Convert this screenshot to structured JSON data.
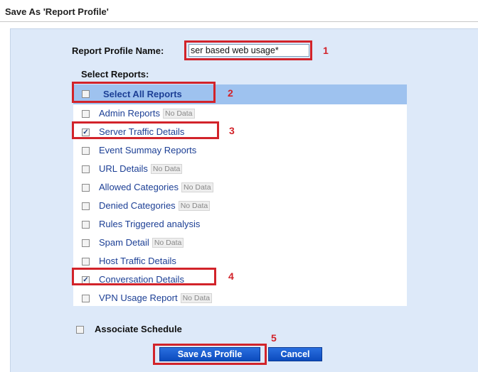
{
  "page": {
    "title": "Save As 'Report Profile'"
  },
  "form": {
    "profile_name_label": "Report Profile Name:",
    "profile_name_value": "ser based web usage*",
    "select_reports_label": "Select Reports:",
    "select_all_label": "Select All Reports",
    "reports": [
      {
        "label": "Admin Reports",
        "no_data": "No Data",
        "checked": false
      },
      {
        "label": "Server Traffic Details",
        "no_data": "",
        "checked": true
      },
      {
        "label": "Event Summay Reports",
        "no_data": "",
        "checked": false
      },
      {
        "label": "URL Details",
        "no_data": "No Data",
        "checked": false
      },
      {
        "label": "Allowed Categories",
        "no_data": "No Data",
        "checked": false
      },
      {
        "label": "Denied Categories",
        "no_data": "No Data",
        "checked": false
      },
      {
        "label": "Rules Triggered analysis",
        "no_data": "",
        "checked": false
      },
      {
        "label": "Spam Detail",
        "no_data": "No Data",
        "checked": false
      },
      {
        "label": "Host Traffic Details",
        "no_data": "",
        "checked": false
      },
      {
        "label": "Conversation Details",
        "no_data": "",
        "checked": true
      },
      {
        "label": "VPN Usage Report",
        "no_data": "No Data",
        "checked": false
      }
    ],
    "associate_schedule_label": "Associate Schedule",
    "save_button": "Save As Profile",
    "cancel_button": "Cancel"
  },
  "annotations": [
    "1",
    "2",
    "3",
    "4",
    "5"
  ],
  "colors": {
    "panel_bg": "#dde9f9",
    "header_row_bg": "#9ec2ef",
    "link_blue": "#1c3f95",
    "annotation_red": "#d2232a",
    "button_blue": "#0c4bbd"
  },
  "icons": {
    "checked": "check-mark",
    "unchecked": "empty-box"
  }
}
